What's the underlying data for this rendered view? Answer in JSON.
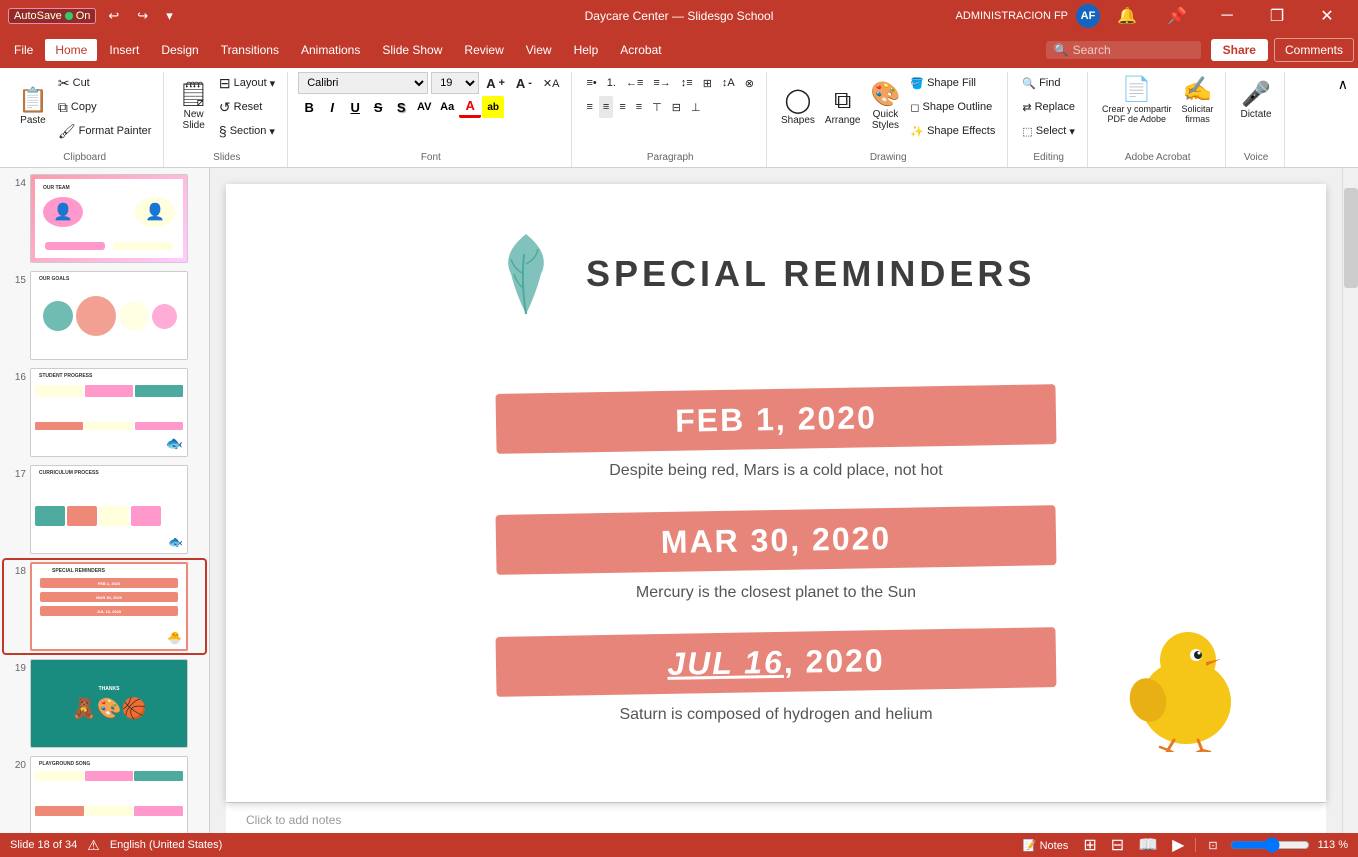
{
  "titlebar": {
    "autosave_label": "AutoSave",
    "autosave_state": "On",
    "title": "Daycare Center — Slidesgo School",
    "user_initials": "AF",
    "admin_label": "ADMINISTRACION FP",
    "undo_icon": "↩",
    "redo_icon": "↪",
    "customize_icon": "▾",
    "minimize_icon": "─",
    "restore_icon": "❐",
    "close_icon": "✕"
  },
  "menubar": {
    "items": [
      "File",
      "Home",
      "Insert",
      "Design",
      "Transitions",
      "Animations",
      "Slide Show",
      "Review",
      "View",
      "Help",
      "Acrobat"
    ],
    "active_item": "Home",
    "search_placeholder": "Search",
    "share_label": "Share",
    "comments_label": "Comments"
  },
  "ribbon": {
    "groups": {
      "clipboard": {
        "label": "Clipboard",
        "paste_label": "Paste",
        "copy_label": "Copy",
        "cut_label": "Cut",
        "format_painter_label": "Format Painter"
      },
      "slides": {
        "label": "Slides",
        "new_slide_label": "New\nSlide",
        "layout_label": "Layout",
        "reset_label": "Reset",
        "section_label": "Section"
      },
      "font": {
        "label": "Font",
        "font_name": "Calibri",
        "font_size": "19",
        "bold": "B",
        "italic": "I",
        "underline": "U",
        "strikethrough": "S",
        "shadow": "S",
        "increase_size": "A↑",
        "decrease_size": "A↓",
        "clear_format": "✕A",
        "font_color": "A",
        "highlight_color": "ab"
      },
      "paragraph": {
        "label": "Paragraph",
        "bullets_label": "Bullets",
        "numbering_label": "Numbering",
        "decrease_indent": "←",
        "increase_indent": "→",
        "line_spacing": "≡",
        "align_left": "≡",
        "align_center": "≡",
        "align_right": "≡",
        "justify": "≡",
        "columns": "⊞",
        "text_direction": "↕",
        "convert_to_smartart": "⊗"
      },
      "drawing": {
        "label": "Drawing",
        "shapes_label": "Shapes",
        "arrange_label": "Arrange",
        "quick_styles_label": "Quick\nStyles",
        "shape_fill_label": "Shape Fill",
        "shape_outline_label": "Shape Outline",
        "shape_effects_label": "Shape Effects"
      },
      "editing": {
        "label": "Editing",
        "find_label": "Find",
        "replace_label": "Replace",
        "select_label": "Select"
      },
      "adobe_acrobat": {
        "label": "Adobe Acrobat",
        "create_pdf_label": "Crear y compartir\nPDF de Adobe",
        "request_sign_label": "Solicitar\nfirmas"
      },
      "voice": {
        "label": "Voice",
        "dictate_label": "Dictate"
      }
    }
  },
  "slide_panel": {
    "slides": [
      {
        "number": "14",
        "active": false
      },
      {
        "number": "15",
        "active": false
      },
      {
        "number": "16",
        "active": false
      },
      {
        "number": "17",
        "active": false
      },
      {
        "number": "18",
        "active": true
      },
      {
        "number": "19",
        "active": false
      },
      {
        "number": "20",
        "active": false
      }
    ]
  },
  "slide18": {
    "title": "SPECIAL REMINDERS",
    "date1": "FEB 1, 2020",
    "desc1": "Despite being red, Mars is a cold place, not hot",
    "date2": "MAR 30, 2020",
    "desc2": "Mercury is the closest planet to the Sun",
    "date3": "JUL 16, 2020",
    "desc3": "Saturn is composed of hydrogen and helium"
  },
  "notes": {
    "placeholder": "Click to add notes"
  },
  "statusbar": {
    "slide_info": "Slide 18 of 34",
    "spell_check": "English (United States)",
    "notes_label": "Notes",
    "zoom_level": "113 %",
    "view_normal_icon": "⊞",
    "view_slide_sorter_icon": "⊟",
    "view_reading_icon": "📖",
    "view_slideshow_icon": "▶"
  }
}
